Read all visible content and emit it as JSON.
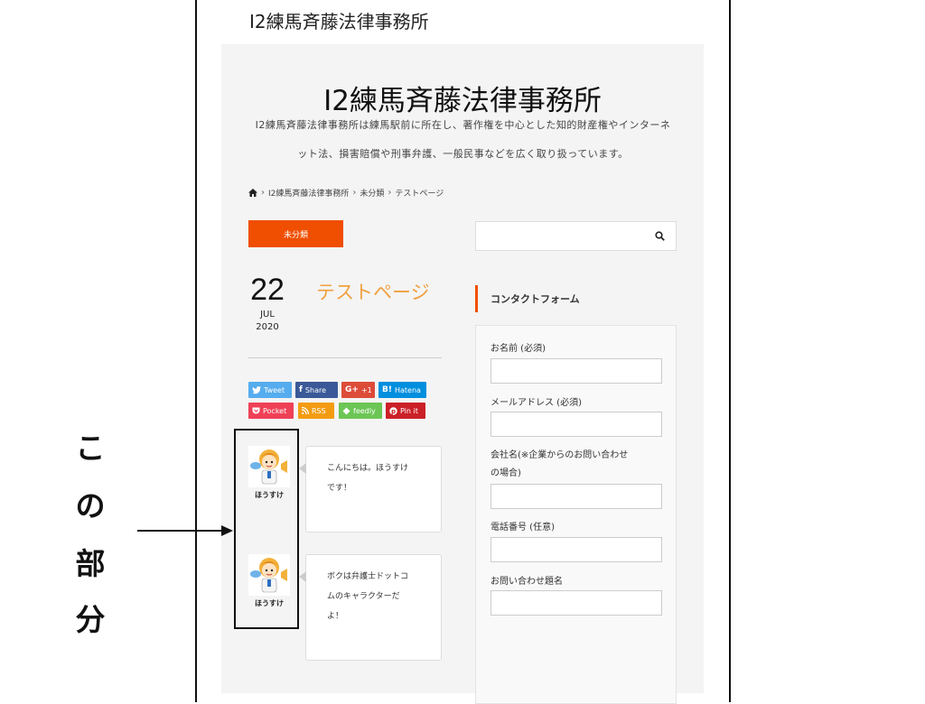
{
  "top_title": "I2練馬斉藤法律事務所",
  "header": {
    "site_title": "I2練馬斉藤法律事務所",
    "description_line1": "I2練馬斉藤法律事務所は練馬駅前に所在し、著作権を中心とした知的財産権やインターネ",
    "description_line2": "ット法、損害賠償や刑事弁護、一般民事などを広く取り扱っています。"
  },
  "breadcrumb": {
    "items": [
      "I2練馬斉藤法律事務所",
      "未分類",
      "テストページ"
    ]
  },
  "post": {
    "category": "未分類",
    "day": "22",
    "month": "JUL",
    "year": "2020",
    "title": "テストページ"
  },
  "share_buttons": [
    {
      "label": "Tweet",
      "icon": "twitter-bird",
      "color": "#55acee"
    },
    {
      "label": "Share",
      "icon": "facebook-f",
      "color": "#3b5998"
    },
    {
      "label": "+1",
      "icon": "G+",
      "color": "#dd4b39"
    },
    {
      "label": "Hatena",
      "icon": "B!",
      "color": "#008fde"
    },
    {
      "label": "Pocket",
      "icon": "pocket",
      "color": "#ef4056"
    },
    {
      "label": "RSS",
      "icon": "rss",
      "color": "#f39c12"
    },
    {
      "label": "feedly",
      "icon": "feedly",
      "color": "#6cc655"
    },
    {
      "label": "Pin it",
      "icon": "pinterest-p",
      "color": "#cb2027"
    }
  ],
  "speech_bubbles": [
    {
      "name": "ほうすけ",
      "lines": [
        "こんにちは。ほうすけ",
        "です！"
      ]
    },
    {
      "name": "ほうすけ",
      "lines": [
        "ボクは弁護士ドットコ",
        "ムのキャラクターだ",
        "よ！"
      ]
    }
  ],
  "sidebar": {
    "widget_title": "コンタクトフォーム",
    "form_fields": [
      {
        "label": "お名前 (必須)"
      },
      {
        "label": "メールアドレス (必須)"
      },
      {
        "label_line1": "会社名(※企業からのお問い合わせ",
        "label_line2": "の場合)"
      },
      {
        "label": "電話番号 (任意)"
      },
      {
        "label": "お問い合わせ題名"
      }
    ]
  },
  "annotation": {
    "chars": [
      "こ",
      "の",
      "部",
      "分"
    ]
  },
  "colors": {
    "accent": "#f04e00",
    "post_title": "#f0a040",
    "panel": "#f4f4f4"
  }
}
